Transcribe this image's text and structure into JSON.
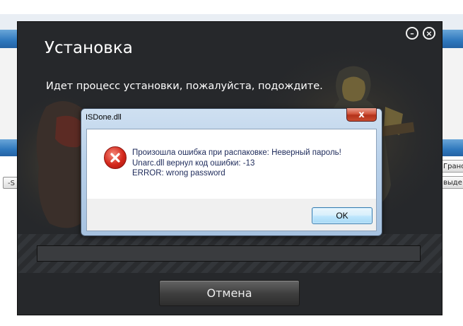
{
  "background_app": {
    "left_button_label": "-S",
    "right_buttons": [
      "Гранс",
      "выде"
    ]
  },
  "installer": {
    "title": "Установка",
    "subtitle": "Идет процесс установки, пожалуйста, подождите.",
    "minimize_glyph": "–",
    "close_glyph": "×",
    "progress": 0,
    "cancel_label": "Отмена"
  },
  "dialog": {
    "title": "ISDone.dll",
    "close_glyph": "x",
    "icon": "error-icon",
    "message_lines": [
      "Произошла ошибка при распаковке: Неверный пароль!",
      "Unarc.dll вернул код ошибки: -13",
      "ERROR: wrong password"
    ],
    "ok_label": "OK"
  },
  "colors": {
    "installer_bg": "#26282b",
    "dialog_frame": "#b9d1ea",
    "error_red": "#d3271b",
    "text_blue": "#1d2a5a"
  }
}
